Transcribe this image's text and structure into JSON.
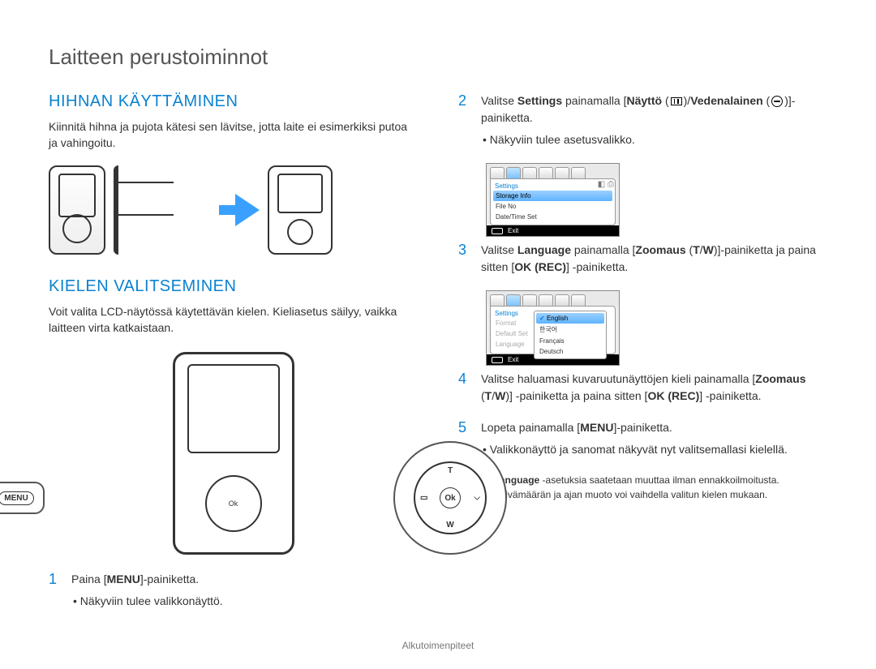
{
  "header": "Laitteen perustoiminnot",
  "left": {
    "section1_title": "HIHNAN KÄYTTÄMINEN",
    "section1_body": "Kiinnitä hihna ja pujota kätesi sen lävitse, jotta laite ei esimerkiksi putoa ja vahingoitu.",
    "section2_title": "KIELEN VALITSEMINEN",
    "section2_body": "Voit valita LCD-näytössä käytettävän kielen. Kieliasetus säilyy, vaikka laitteen virta katkaistaan.",
    "menu_label": "MENU",
    "dpad": {
      "t": "T",
      "w": "W",
      "ok": "Ok"
    },
    "step1": {
      "num": "1",
      "pre": "Paina [",
      "bold": "MENU",
      "post": "]-painiketta.",
      "bullet": "Näkyviin tulee valikkonäyttö."
    }
  },
  "right": {
    "step2": {
      "num": "2",
      "t1": "Valitse ",
      "b1": "Settings",
      "t2": " painamalla [",
      "b2": "Näyttö",
      "t3": " (",
      "t4": ")/",
      "b3": "Vedenalainen",
      "t5": " (",
      "t6": ")]-painiketta.",
      "bullet": "Näkyviin tulee asetusvalikko."
    },
    "screenshot1": {
      "hdr": "Settings",
      "rows": [
        "Storage Info",
        "File No",
        "Date/Time Set"
      ],
      "selected": "Storage Info",
      "exit": "Exit"
    },
    "step3": {
      "num": "3",
      "t1": "Valitse ",
      "b1": "Language",
      "t2": " painamalla [",
      "b2": "Zoomaus",
      "t3": " (",
      "b3": "T",
      "t4": "/",
      "b4": "W",
      "t5": ")]-painiketta ja paina sitten [",
      "b5": "OK (REC)",
      "t6": "] -painiketta."
    },
    "screenshot2": {
      "hdr": "Settings",
      "rows": [
        "Format",
        "Default Set",
        "Language"
      ],
      "submenu": [
        "English",
        "한국어",
        "Français",
        "Deutsch"
      ],
      "submenu_selected": "English",
      "exit": "Exit"
    },
    "step4": {
      "num": "4",
      "t1": "Valitse haluamasi kuvaruutunäyttöjen kieli painamalla [",
      "b1": "Zoomaus",
      "t2": " (",
      "b2": "T",
      "t3": "/",
      "b3": "W",
      "t4": ")] -painiketta ja paina sitten [",
      "b4": "OK (REC)",
      "t5": "] -painiketta."
    },
    "step5": {
      "num": "5",
      "t1": "Lopeta painamalla [",
      "b1": "MENU",
      "t2": "]-painiketta.",
      "bullet": "Valikkonäyttö ja sanomat näkyvät nyt valitsemallasi kielellä."
    },
    "notes": [
      "Language -asetuksia saatetaan muuttaa ilman ennakkoilmoitusta.",
      "Päivämäärän ja ajan muoto voi vaihdella valitun kielen mukaan."
    ],
    "note_bold": "Language"
  },
  "footer": "Alkutoimenpiteet"
}
